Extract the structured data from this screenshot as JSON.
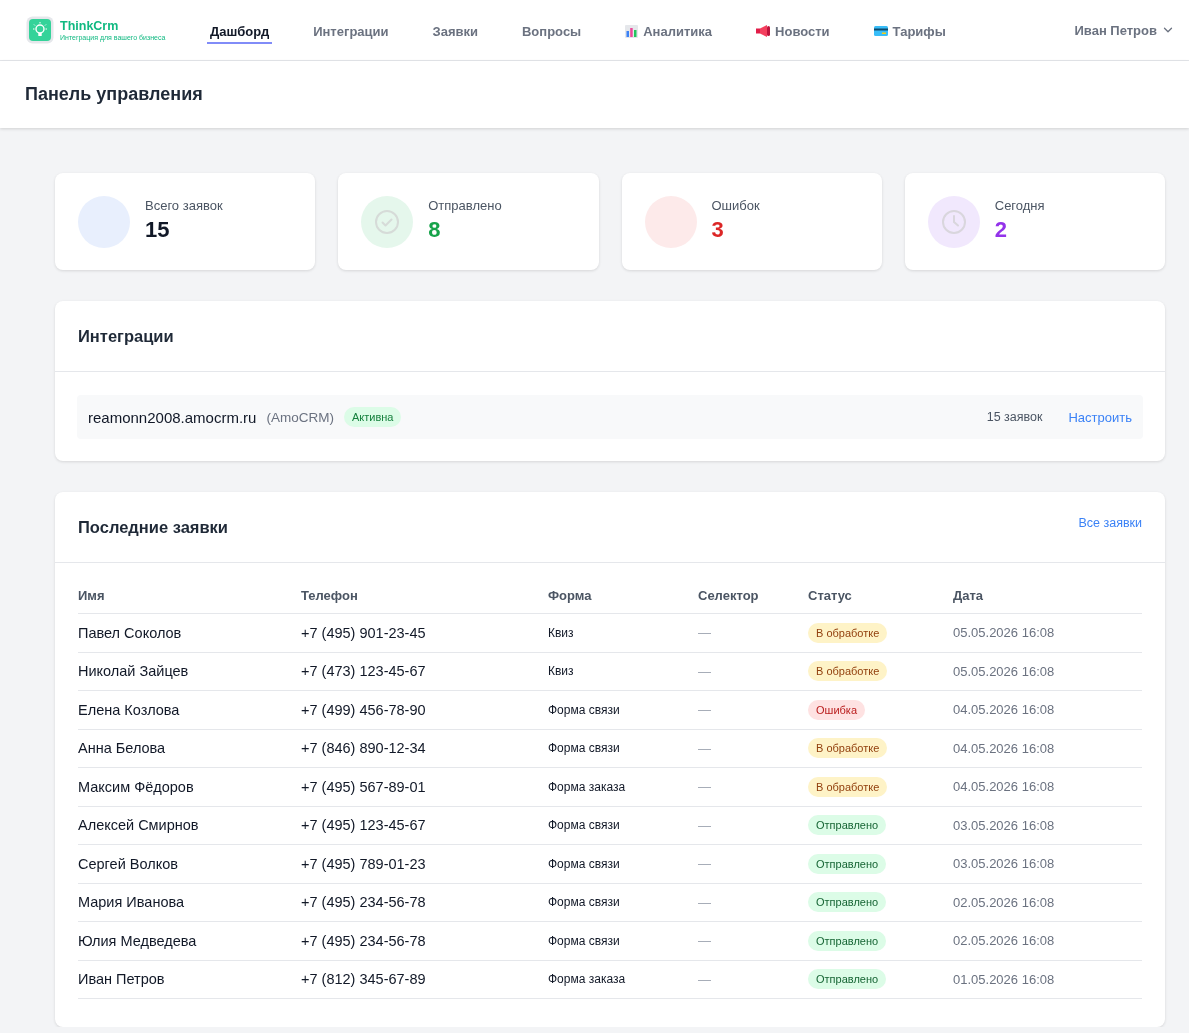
{
  "header": {
    "logo": {
      "name": "ThinkCrm",
      "tagline": "Интеграция для вашего бизнеса"
    },
    "nav": [
      {
        "label": "Дашборд",
        "selected": true,
        "kind": "plain"
      },
      {
        "label": "Интеграции",
        "selected": false,
        "kind": "plain"
      },
      {
        "label": "Заявки",
        "selected": false,
        "kind": "plain"
      },
      {
        "label": "Вопросы",
        "selected": false,
        "kind": "plain"
      },
      {
        "label": "Аналитика",
        "selected": false,
        "kind": "chart"
      },
      {
        "label": "Новости",
        "selected": false,
        "kind": "megaphone"
      },
      {
        "label": "Тарифы",
        "selected": false,
        "kind": "card"
      }
    ],
    "user": {
      "name": "Иван Петров"
    }
  },
  "page_title": "Панель управления",
  "stats": [
    {
      "label": "Всего заявок",
      "value": "15",
      "kind": "total"
    },
    {
      "label": "Отправлено",
      "value": "8",
      "kind": "sent"
    },
    {
      "label": "Ошибок",
      "value": "3",
      "kind": "errors"
    },
    {
      "label": "Сегодня",
      "value": "2",
      "kind": "today"
    }
  ],
  "integrations": {
    "title": "Интеграции",
    "items": [
      {
        "domain": "reamonn2008.amocrm.ru",
        "platform": "(AmoCRM)",
        "status": {
          "label": "Активна",
          "kind": "active"
        },
        "count": "15 заявок",
        "action": "Настроить"
      }
    ]
  },
  "recent": {
    "title": "Последние заявки",
    "link": "Все заявки",
    "table": {
      "columns": [
        "Имя",
        "Телефон",
        "Форма",
        "Селектор",
        "Статус",
        "Дата"
      ],
      "rows": [
        {
          "name": "Павел Соколов",
          "phone": "+7 (495) 901-23-45",
          "form": "Квиз",
          "selector": "—",
          "status": {
            "label": "В обработке",
            "kind": "pending"
          },
          "date": "05.05.2026 16:08"
        },
        {
          "name": "Николай Зайцев",
          "phone": "+7 (473) 123-45-67",
          "form": "Квиз",
          "selector": "—",
          "status": {
            "label": "В обработке",
            "kind": "pending"
          },
          "date": "05.05.2026 16:08"
        },
        {
          "name": "Елена Козлова",
          "phone": "+7 (499) 456-78-90",
          "form": "Форма связи",
          "selector": "—",
          "status": {
            "label": "Ошибка",
            "kind": "error"
          },
          "date": "04.05.2026 16:08"
        },
        {
          "name": "Анна Белова",
          "phone": "+7 (846) 890-12-34",
          "form": "Форма связи",
          "selector": "—",
          "status": {
            "label": "В обработке",
            "kind": "pending"
          },
          "date": "04.05.2026 16:08"
        },
        {
          "name": "Максим Фёдоров",
          "phone": "+7 (495) 567-89-01",
          "form": "Форма заказа",
          "selector": "—",
          "status": {
            "label": "В обработке",
            "kind": "pending"
          },
          "date": "04.05.2026 16:08"
        },
        {
          "name": "Алексей Смирнов",
          "phone": "+7 (495) 123-45-67",
          "form": "Форма связи",
          "selector": "—",
          "status": {
            "label": "Отправлено",
            "kind": "sent"
          },
          "date": "03.05.2026 16:08"
        },
        {
          "name": "Сергей Волков",
          "phone": "+7 (495) 789-01-23",
          "form": "Форма связи",
          "selector": "—",
          "status": {
            "label": "Отправлено",
            "kind": "sent"
          },
          "date": "03.05.2026 16:08"
        },
        {
          "name": "Мария Иванова",
          "phone": "+7 (495) 234-56-78",
          "form": "Форма связи",
          "selector": "—",
          "status": {
            "label": "Отправлено",
            "kind": "sent"
          },
          "date": "02.05.2026 16:08"
        },
        {
          "name": "Юлия Медведева",
          "phone": "+7 (495) 234-56-78",
          "form": "Форма связи",
          "selector": "—",
          "status": {
            "label": "Отправлено",
            "kind": "sent"
          },
          "date": "02.05.2026 16:08"
        },
        {
          "name": "Иван Петров",
          "phone": "+7 (812) 345-67-89",
          "form": "Форма заказа",
          "selector": "—",
          "status": {
            "label": "Отправлено",
            "kind": "sent"
          },
          "date": "01.05.2026 16:08"
        }
      ]
    }
  }
}
